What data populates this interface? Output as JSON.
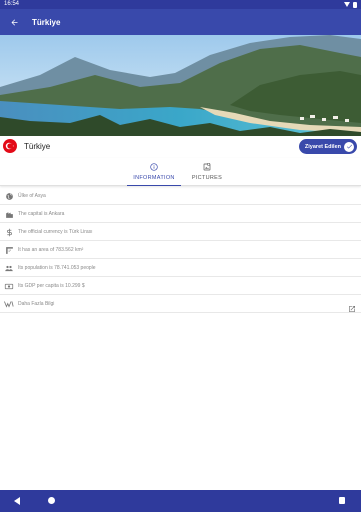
{
  "status_bar": {
    "time": "16:54"
  },
  "app_bar": {
    "title": "Türkiye"
  },
  "country": {
    "name": "Türkiye"
  },
  "visited_button": {
    "label": "Ziyaret Edilen"
  },
  "tabs": [
    {
      "label": "INFORMATION",
      "icon": "info-icon",
      "selected": true
    },
    {
      "label": "PICTURES",
      "icon": "pictures-icon",
      "selected": false
    }
  ],
  "info_rows": [
    {
      "icon": "globe-icon",
      "text": "Ülke of Asya"
    },
    {
      "icon": "capital-building-icon",
      "text": "The capital is Ankara"
    },
    {
      "icon": "dollar-icon",
      "text": "The official currency is Türk Lirası"
    },
    {
      "icon": "area-icon",
      "text": "It has an area of 783.562 km²"
    },
    {
      "icon": "people-icon",
      "text": "Its population is 78.741.053 people"
    },
    {
      "icon": "money-icon",
      "text": "Its GDP per capita is 10.299 $"
    },
    {
      "icon": "wikipedia-icon",
      "text": "Daha Fazla Bilgi"
    }
  ],
  "colors": {
    "primary": "#3949ab",
    "primary_dark": "#2f3a9c",
    "flag_red": "#e30a17"
  }
}
